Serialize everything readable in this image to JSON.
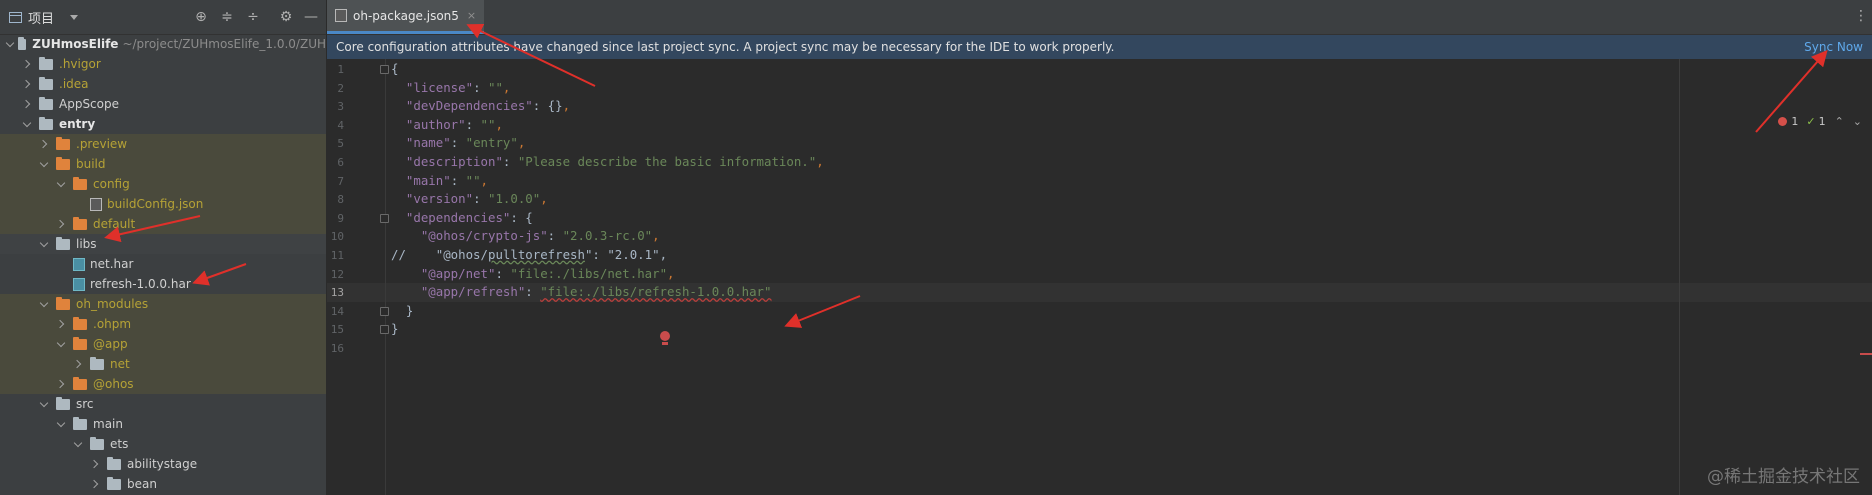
{
  "sidebar": {
    "title": "项目",
    "tree": [
      {
        "label": "ZUHmosElife",
        "path": "~/project/ZUHmosElife_1.0.0/ZUH",
        "chevron": "down",
        "kind": "folder-grey",
        "style": "bold",
        "depth": 0
      },
      {
        "label": ".hvigor",
        "chevron": "right",
        "kind": "folder-grey",
        "style": "olive",
        "depth": 1
      },
      {
        "label": ".idea",
        "chevron": "right",
        "kind": "folder-grey",
        "style": "olive",
        "depth": 1
      },
      {
        "label": "AppScope",
        "chevron": "right",
        "kind": "folder-grey",
        "style": "normal",
        "depth": 1
      },
      {
        "label": "entry",
        "chevron": "down",
        "kind": "folder-grey",
        "style": "bold",
        "depth": 1
      },
      {
        "label": ".preview",
        "chevron": "right",
        "kind": "folder-orange",
        "style": "olive",
        "depth": 2,
        "hl": true
      },
      {
        "label": "build",
        "chevron": "down",
        "kind": "folder-orange",
        "style": "olive",
        "depth": 2,
        "hl": true
      },
      {
        "label": "config",
        "chevron": "down",
        "kind": "folder-orange",
        "style": "olive",
        "depth": 3,
        "hl": true
      },
      {
        "label": "buildConfig.json",
        "chevron": "none",
        "kind": "json",
        "style": "olive",
        "depth": 4,
        "hl": true
      },
      {
        "label": "default",
        "chevron": "right",
        "kind": "folder-orange",
        "style": "olive",
        "depth": 3,
        "hl": true
      },
      {
        "label": "libs",
        "chevron": "down",
        "kind": "folder-grey",
        "style": "normal",
        "depth": 2,
        "sel": true
      },
      {
        "label": "net.har",
        "chevron": "none",
        "kind": "har",
        "style": "normal",
        "depth": 3
      },
      {
        "label": "refresh-1.0.0.har",
        "chevron": "none",
        "kind": "har",
        "style": "normal",
        "depth": 3
      },
      {
        "label": "oh_modules",
        "chevron": "down",
        "kind": "folder-orange",
        "style": "olive",
        "depth": 2,
        "hl": true
      },
      {
        "label": ".ohpm",
        "chevron": "right",
        "kind": "folder-orange",
        "style": "olive",
        "depth": 3,
        "hl": true
      },
      {
        "label": "@app",
        "chevron": "down",
        "kind": "folder-orange",
        "style": "olive",
        "depth": 3,
        "hl": true
      },
      {
        "label": "net",
        "chevron": "right",
        "kind": "folder-link",
        "style": "olive",
        "depth": 4,
        "hl": true
      },
      {
        "label": "@ohos",
        "chevron": "right",
        "kind": "folder-orange",
        "style": "olive",
        "depth": 3,
        "hl": true
      },
      {
        "label": "src",
        "chevron": "down",
        "kind": "folder-grey",
        "style": "normal",
        "depth": 2
      },
      {
        "label": "main",
        "chevron": "down",
        "kind": "folder-grey",
        "style": "normal",
        "depth": 3
      },
      {
        "label": "ets",
        "chevron": "down",
        "kind": "folder-grey",
        "style": "normal",
        "depth": 4
      },
      {
        "label": "abilitystage",
        "chevron": "right",
        "kind": "folder-grey",
        "style": "normal",
        "depth": 5
      },
      {
        "label": "bean",
        "chevron": "right",
        "kind": "folder-grey",
        "style": "normal",
        "depth": 5
      }
    ]
  },
  "tab": {
    "label": "oh-package.json5",
    "close": "×"
  },
  "banner": {
    "message": "Core configuration attributes have changed since last project sync. A project sync may be necessary for the IDE to work properly.",
    "sync_label": "Sync Now"
  },
  "inspections": {
    "errors": "1",
    "warnings": "1",
    "up": "⌃",
    "down": "⌄"
  },
  "editor": {
    "lines": [
      {
        "n": "1",
        "code": "{"
      },
      {
        "n": "2",
        "code": "  \"license\": \"\","
      },
      {
        "n": "3",
        "code": "  \"devDependencies\": {},"
      },
      {
        "n": "4",
        "code": "  \"author\": \"\","
      },
      {
        "n": "5",
        "code": "  \"name\": \"entry\","
      },
      {
        "n": "6",
        "code": "  \"description\": \"Please describe the basic information.\","
      },
      {
        "n": "7",
        "code": "  \"main\": \"\","
      },
      {
        "n": "8",
        "code": "  \"version\": \"1.0.0\","
      },
      {
        "n": "9",
        "code": "  \"dependencies\": {"
      },
      {
        "n": "10",
        "code": "    \"@ohos/crypto-js\": \"2.0.3-rc.0\","
      },
      {
        "n": "11",
        "code": "//    \"@ohos/pulltorefresh\": \"2.0.1\","
      },
      {
        "n": "12",
        "code": "    \"@app/net\": \"file:./libs/net.har\","
      },
      {
        "n": "13",
        "code": "    \"@app/refresh\": \"file:./libs/refresh-1.0.0.har\""
      },
      {
        "n": "14",
        "code": "  }"
      },
      {
        "n": "15",
        "code": "}"
      },
      {
        "n": "16",
        "code": ""
      }
    ],
    "current_line": "13"
  },
  "watermark": "@稀土掘金技术社区",
  "colors": {
    "annotation_arrow": "#e0302a",
    "accent": "#4a88c7",
    "banner_bg": "#33475e",
    "link": "#5fa8ea"
  }
}
